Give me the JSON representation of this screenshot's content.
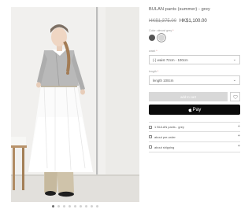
{
  "product": {
    "title": "BULAN pants (summer) - grey",
    "old_price": "HK$1,375.00",
    "new_price": "HK$1,100.00"
  },
  "options": {
    "color": {
      "label": "Color: almost grey",
      "required_mark": "*"
    },
    "waist": {
      "label": "waist",
      "required_mark": "*",
      "value": "(-) waist 72cm - 100cm"
    },
    "length": {
      "label": "length",
      "required_mark": "*",
      "value": "length 100cm"
    }
  },
  "actions": {
    "add_to_cart": "add to cart",
    "pay_label": "Pay"
  },
  "accordion": [
    {
      "label": "1 BULAN pants - grey",
      "icon": "tag-icon"
    },
    {
      "label": "about pre-order",
      "icon": "clock-icon"
    },
    {
      "label": "about shipping",
      "icon": "truck-icon"
    }
  ],
  "gallery": {
    "total_images": 9,
    "active_index": 0
  },
  "colors": {
    "swatch_dark": "#555555",
    "swatch_light": "#d6d6d6",
    "pay_button": "#0b0b0b",
    "add_button_disabled": "#d8d8d8"
  }
}
